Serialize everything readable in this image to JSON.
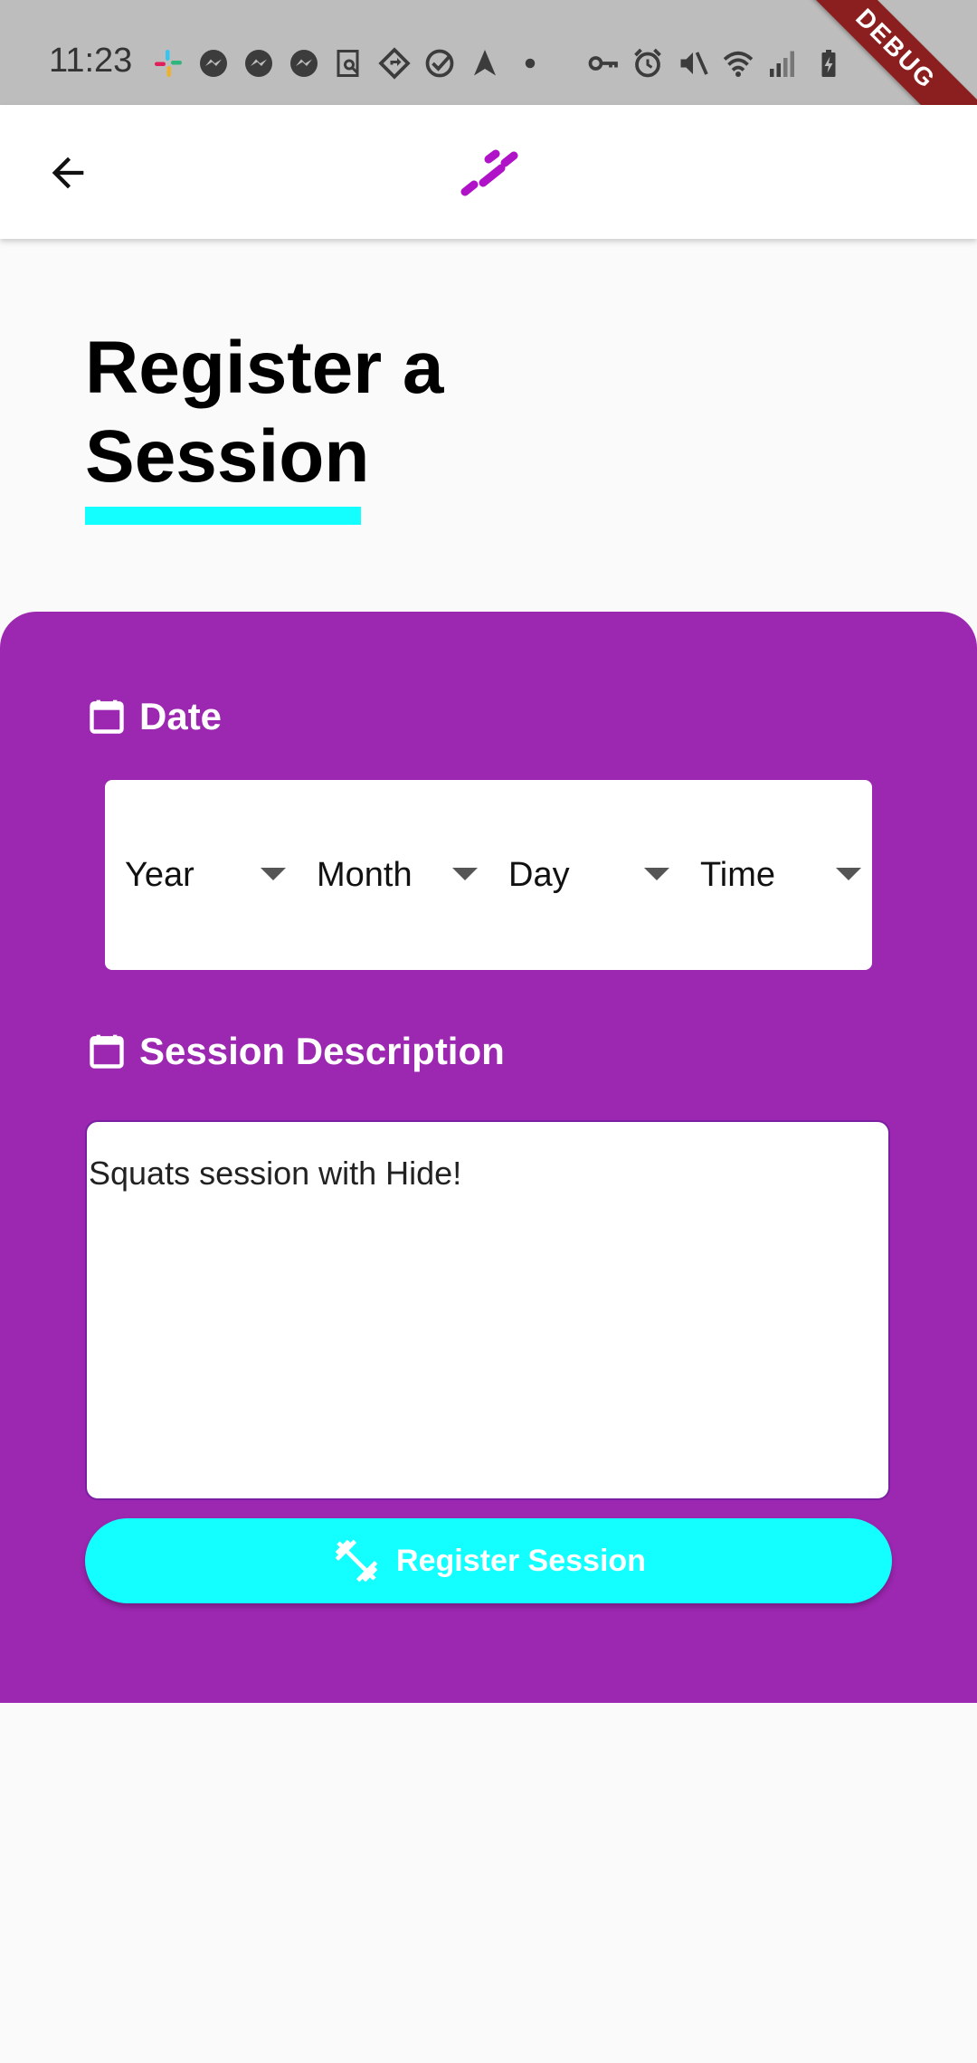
{
  "status_bar": {
    "time": "11:23",
    "debug_label": "DEBUG"
  },
  "app_bar": {
    "back_icon": "arrow-back-icon",
    "logo_icon": "app-logo-icon",
    "logo_color": "#9c27b0"
  },
  "page": {
    "title": "Register a Session",
    "accent_color": "#13ffff",
    "panel_color": "#9c27b0"
  },
  "date_section": {
    "label": "Date",
    "icon": "calendar-icon",
    "dropdowns": [
      {
        "label": "Year"
      },
      {
        "label": "Month"
      },
      {
        "label": "Day"
      },
      {
        "label": "Time"
      }
    ]
  },
  "description_section": {
    "label": "Session Description",
    "icon": "calendar-icon",
    "value": "Squats session with Hide!"
  },
  "actions": {
    "register_label": "Register Session",
    "register_icon": "fitness-center-icon"
  }
}
